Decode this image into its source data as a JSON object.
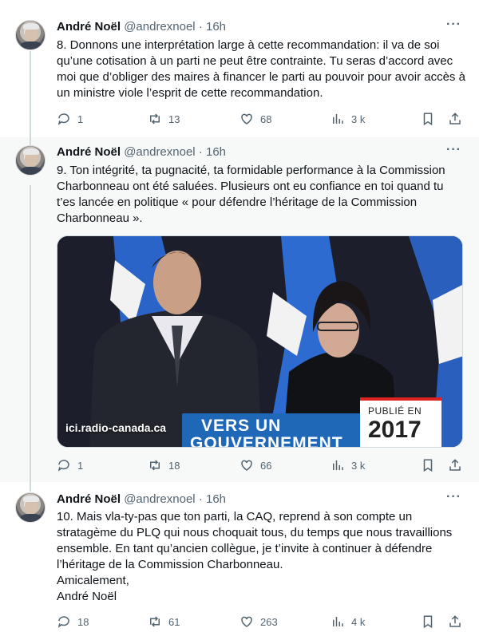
{
  "tweets": [
    {
      "author_name": "André Noël",
      "handle": "@andrexnoel",
      "separator": "·",
      "time": "16h",
      "text": "8. Donnons une interprétation large à cette recommandation: il va de soi qu’une cotisation à un parti ne peut être contrainte. Tu seras d’accord avec moi que d’obliger des maires à financer le parti au pouvoir pour avoir accès à un ministre viole l’esprit de cette recommandation.",
      "replies": "1",
      "retweets": "13",
      "likes": "68",
      "views": "3 k"
    },
    {
      "author_name": "André Noël",
      "handle": "@andrexnoel",
      "separator": "·",
      "time": "16h",
      "text": "9. Ton intégrité, ta pugnacité, ta formidable performance à la Commission Charbonneau ont été saluées. Plusieurs ont eu confiance en toi quand tu t’es lancée en politique « pour défendre l’héritage de la Commission Charbonneau ».",
      "media": {
        "watermark": "ici.radio-canada.ca",
        "published_label": "PUBLIÉ EN",
        "published_year": "2017",
        "banner_line1": "VERS UN",
        "banner_line2": "GOUVERNEMENT"
      },
      "replies": "1",
      "retweets": "18",
      "likes": "66",
      "views": "3 k"
    },
    {
      "author_name": "André Noël",
      "handle": "@andrexnoel",
      "separator": "·",
      "time": "16h",
      "text": "10. Mais vla-ty-pas que ton parti, la CAQ, reprend à son compte un stratagème du PLQ qui nous choquait tous, du temps que nous travaillions ensemble. En tant qu’ancien collègue, je t’invite à continuer à défendre l’héritage de la Commission Charbonneau.\n   Amicalement,\nAndré Noël",
      "replies": "18",
      "retweets": "61",
      "likes": "263",
      "views": "4 k"
    }
  ],
  "icons": {
    "more": "more-icon",
    "reply": "reply-icon",
    "retweet": "retweet-icon",
    "like": "heart-icon",
    "views": "views-icon",
    "bookmark": "bookmark-icon",
    "share": "share-icon"
  },
  "colors": {
    "text": "#0f1419",
    "secondary": "#536471",
    "thread_line": "#cfd9de",
    "highlight_bg": "#f7f9f9"
  }
}
